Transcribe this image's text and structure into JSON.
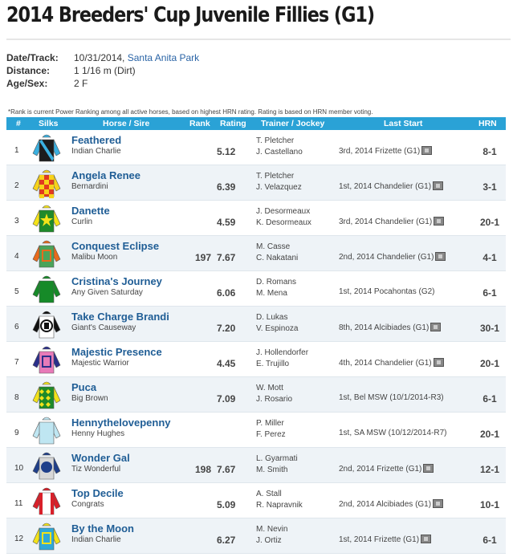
{
  "page": {
    "title": "2014 Breeders' Cup Juvenile Fillies (G1)"
  },
  "race_info": {
    "date_label": "Date/Track:",
    "date": "10/31/2014,",
    "track": "Santa Anita Park",
    "distance_label": "Distance:",
    "distance": "1 1/16 m (Dirt)",
    "age_label": "Age/Sex:",
    "age": "2 F"
  },
  "note": "*Rank is current Power Ranking among all active horses, based on highest HRN rating. Rating is based on HRN member voting.",
  "table": {
    "headers": {
      "num": "#",
      "silks": "Silks",
      "horse": "Horse / Sire",
      "rank": "Rank",
      "rating": "Rating",
      "trainer": "Trainer / Jockey",
      "last": "Last Start",
      "hrn": "HRN"
    },
    "rows": [
      {
        "num": "1",
        "horse": "Feathered",
        "sire": "Indian Charlie",
        "rank": "",
        "rating": "5.12",
        "trainer": "T. Pletcher",
        "jockey": "J. Castellano",
        "last": "3rd, 2014 Frizette (G1)",
        "video": true,
        "hrn": "8-1",
        "silk": {
          "body": "#1c1c1c",
          "accent": "#3ab0e0",
          "pattern": "sash"
        }
      },
      {
        "num": "2",
        "horse": "Angela Renee",
        "sire": "Bernardini",
        "rank": "",
        "rating": "6.39",
        "trainer": "T. Pletcher",
        "jockey": "J. Velazquez",
        "last": "1st, 2014 Chandelier (G1)",
        "video": true,
        "hrn": "3-1",
        "silk": {
          "body": "#e23a1f",
          "accent": "#f7d21a",
          "pattern": "check"
        }
      },
      {
        "num": "3",
        "horse": "Danette",
        "sire": "Curlin",
        "rank": "",
        "rating": "4.59",
        "trainer": "J. Desormeaux",
        "jockey": "K. Desormeaux",
        "last": "3rd, 2014 Chandelier (G1)",
        "video": true,
        "hrn": "20-1",
        "silk": {
          "body": "#1f8a2a",
          "accent": "#f5e31a",
          "pattern": "star"
        }
      },
      {
        "num": "4",
        "horse": "Conquest Eclipse",
        "sire": "Malibu Moon",
        "rank": "197",
        "rating": "7.67",
        "trainer": "M. Casse",
        "jockey": "C. Nakatani",
        "last": "2nd, 2014 Chandelier (G1)",
        "video": true,
        "hrn": "4-1",
        "silk": {
          "body": "#4aa35a",
          "accent": "#e86a1c",
          "pattern": "letter"
        }
      },
      {
        "num": "5",
        "horse": "Cristina's Journey",
        "sire": "Any Given Saturday",
        "rank": "",
        "rating": "6.06",
        "trainer": "D. Romans",
        "jockey": "M. Mena",
        "last": "1st, 2014 Pocahontas (G2)",
        "video": false,
        "hrn": "6-1",
        "silk": {
          "body": "#168a28",
          "accent": "#168a28",
          "pattern": "plain"
        }
      },
      {
        "num": "6",
        "horse": "Take Charge Brandi",
        "sire": "Giant's Causeway",
        "rank": "",
        "rating": "7.20",
        "trainer": "D. Lukas",
        "jockey": "V. Espinoza",
        "last": "8th, 2014 Alcibiades (G1)",
        "video": true,
        "hrn": "30-1",
        "silk": {
          "body": "#ffffff",
          "accent": "#111111",
          "pattern": "bars"
        }
      },
      {
        "num": "7",
        "horse": "Majestic Presence",
        "sire": "Majestic Warrior",
        "rank": "",
        "rating": "4.45",
        "trainer": "J. Hollendorfer",
        "jockey": "E. Trujillo",
        "last": "4th, 2014 Chandelier (G1)",
        "video": true,
        "hrn": "20-1",
        "silk": {
          "body": "#e87ab8",
          "accent": "#2a2f8a",
          "pattern": "letter"
        }
      },
      {
        "num": "8",
        "horse": "Puca",
        "sire": "Big Brown",
        "rank": "",
        "rating": "7.09",
        "trainer": "W. Mott",
        "jockey": "J. Rosario",
        "last": "1st, Bel MSW (10/1/2014-R3)",
        "video": false,
        "hrn": "6-1",
        "silk": {
          "body": "#1e8a2a",
          "accent": "#f2e21a",
          "pattern": "diamonds"
        }
      },
      {
        "num": "9",
        "horse": "Hennythelovepenny",
        "sire": "Henny Hughes",
        "rank": "",
        "rating": "",
        "trainer": "P. Miller",
        "jockey": "F. Perez",
        "last": "1st, SA MSW (10/12/2014-R7)",
        "video": false,
        "hrn": "20-1",
        "silk": {
          "body": "#bfe6f2",
          "accent": "#bfe6f2",
          "pattern": "plain"
        }
      },
      {
        "num": "10",
        "horse": "Wonder Gal",
        "sire": "Tiz Wonderful",
        "rank": "198",
        "rating": "7.67",
        "trainer": "L. Gyarmati",
        "jockey": "M. Smith",
        "last": "2nd, 2014 Frizette (G1)",
        "video": true,
        "hrn": "12-1",
        "silk": {
          "body": "#d8d8d8",
          "accent": "#1f3f8a",
          "pattern": "circle"
        }
      },
      {
        "num": "11",
        "horse": "Top Decile",
        "sire": "Congrats",
        "rank": "",
        "rating": "5.09",
        "trainer": "A. Stall",
        "jockey": "R. Napravnik",
        "last": "2nd, 2014 Alcibiades (G1)",
        "video": true,
        "hrn": "10-1",
        "silk": {
          "body": "#ffffff",
          "accent": "#d8202a",
          "pattern": "stripe"
        }
      },
      {
        "num": "12",
        "horse": "By the Moon",
        "sire": "Indian Charlie",
        "rank": "",
        "rating": "6.27",
        "trainer": "M. Nevin",
        "jockey": "J. Ortiz",
        "last": "1st, 2014 Frizette (G1)",
        "video": true,
        "hrn": "6-1",
        "silk": {
          "body": "#2fa8d8",
          "accent": "#f2e21a",
          "pattern": "letter"
        }
      }
    ]
  }
}
